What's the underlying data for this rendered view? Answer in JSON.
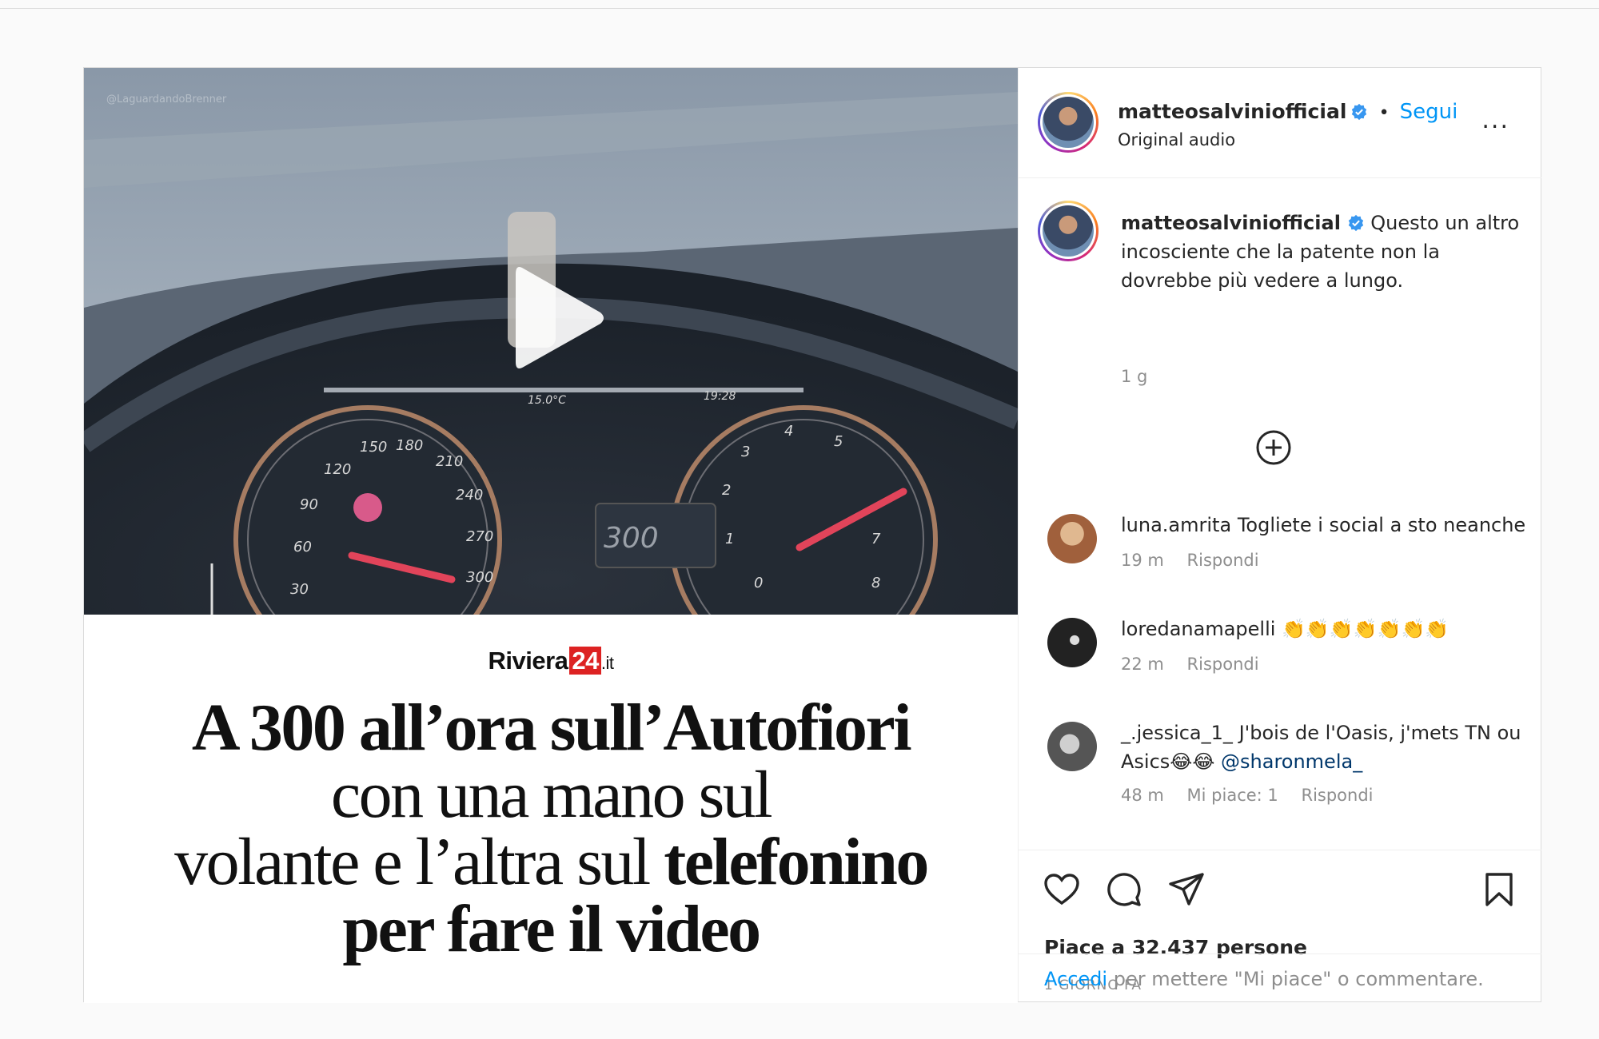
{
  "post": {
    "video": {
      "watermark": "@LaguardandoBrenner",
      "play_icon": "play-icon"
    },
    "article": {
      "brand_name": "Riviera",
      "brand_number": "24",
      "brand_tld": ".it",
      "headline": {
        "line1": "A 300 all’ora sull’Autofiori",
        "line2": "con una mano sul",
        "line3_regular": "volante e l’altra sul ",
        "line3_bold": "telefonino",
        "line4": "per fare il video"
      }
    }
  },
  "header": {
    "username": "matteosalviniofficial",
    "separator": "•",
    "follow_label": "Segui",
    "audio_label": "Original audio",
    "more_label": "..."
  },
  "caption": {
    "username": "matteosalviniofficial",
    "text": "Questo un altro incosciente che la patente non la dovrebbe più vedere a lungo.",
    "time": "1 g"
  },
  "load_more_icon": "plus-circle-icon",
  "comments": [
    {
      "username": "luna.amrita",
      "text": "Togliete i social a sto neanche",
      "time": "19 m",
      "likes": "",
      "reply_label": "Rispondi"
    },
    {
      "username": "loredanamapelli",
      "text": "👏👏👏👏👏👏👏",
      "time": "22 m",
      "likes": "",
      "reply_label": "Rispondi"
    },
    {
      "username": "_.jessica_1_",
      "text": "J'bois de l'Oasis, j'mets TN ou Asics😂😂",
      "mention": "@sharonmela_",
      "time": "48 m",
      "likes": "Mi piace: 1",
      "reply_label": "Rispondi"
    }
  ],
  "actions": {
    "like_icon": "heart-icon",
    "comment_icon": "comment-icon",
    "share_icon": "share-icon",
    "save_icon": "bookmark-icon"
  },
  "likes_text": "Piace a 32.437 persone",
  "timestamp": "1 GIORNO FA",
  "login": {
    "link": "Accedi",
    "rest": " per mettere \"Mi piace\" o commentare."
  },
  "colors": {
    "accent": "#0095f6",
    "text": "#262626",
    "muted": "#8e8e8e",
    "border": "#dbdbdb",
    "brand_red": "#dd2222"
  }
}
